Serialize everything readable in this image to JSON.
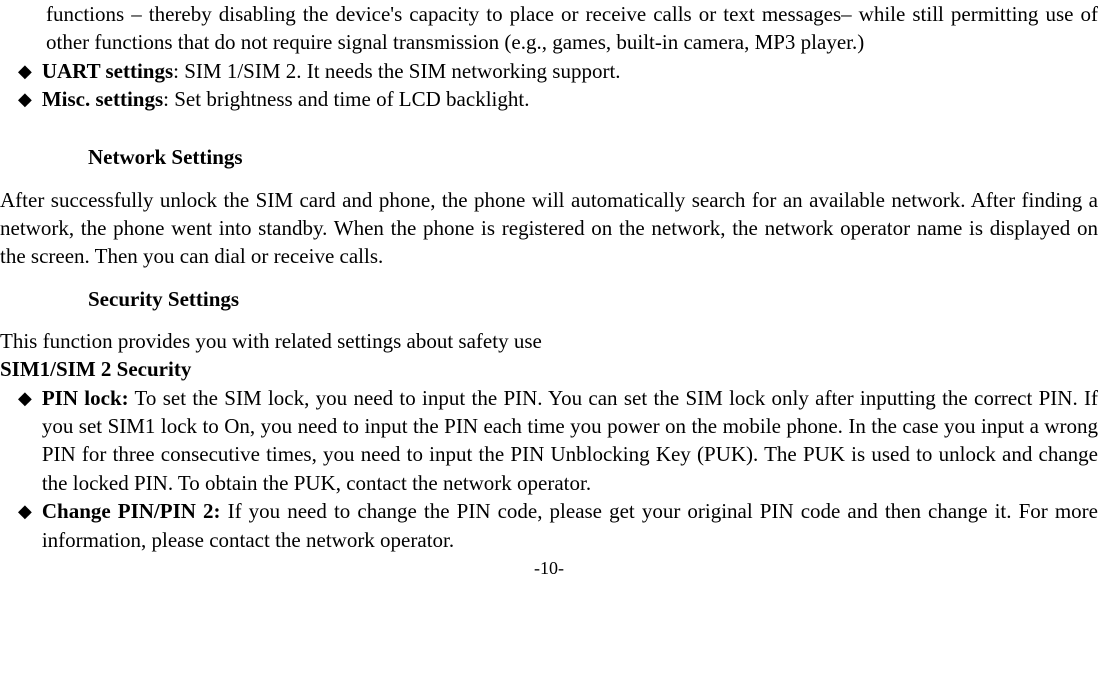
{
  "topFragment": "functions – thereby disabling the device's capacity to place or receive calls or text messages– while still permitting use of other functions that do not require signal transmission (e.g., games, built-in camera, MP3 player.)",
  "bullets1": [
    {
      "label": "UART settings",
      "text": ": SIM 1/SIM 2. It needs the SIM networking support."
    },
    {
      "label": "Misc. settings",
      "text": ": Set brightness and time of LCD backlight."
    }
  ],
  "heading1": "Network Settings",
  "para1": "After successfully unlock the SIM card and phone, the phone will automatically search for an available network. After finding a network, the phone went into standby. When the phone is registered on the network, the network operator name is displayed on the screen. Then you can dial or receive calls.",
  "heading2": "Security Settings",
  "para2": "This function provides you with related settings about safety use",
  "subheading": "SIM1/SIM 2 Security",
  "bullets2": [
    {
      "label": "PIN lock:",
      "text": " To set the SIM lock, you need to input the PIN. You can set the SIM lock only after inputting the correct PIN. If you set SIM1 lock to On, you need to input the PIN each time you power on the mobile phone. In the case you input a wrong PIN for three consecutive times, you need to input the PIN Unblocking Key (PUK). The PUK is used to unlock and change the locked PIN. To obtain the PUK, contact the network operator."
    },
    {
      "label": "Change PIN/PIN 2:",
      "text": " If you need to change the PIN code, please get your original PIN code and then change it. For more information, please contact the network operator."
    }
  ],
  "pageNumber": "-10-"
}
